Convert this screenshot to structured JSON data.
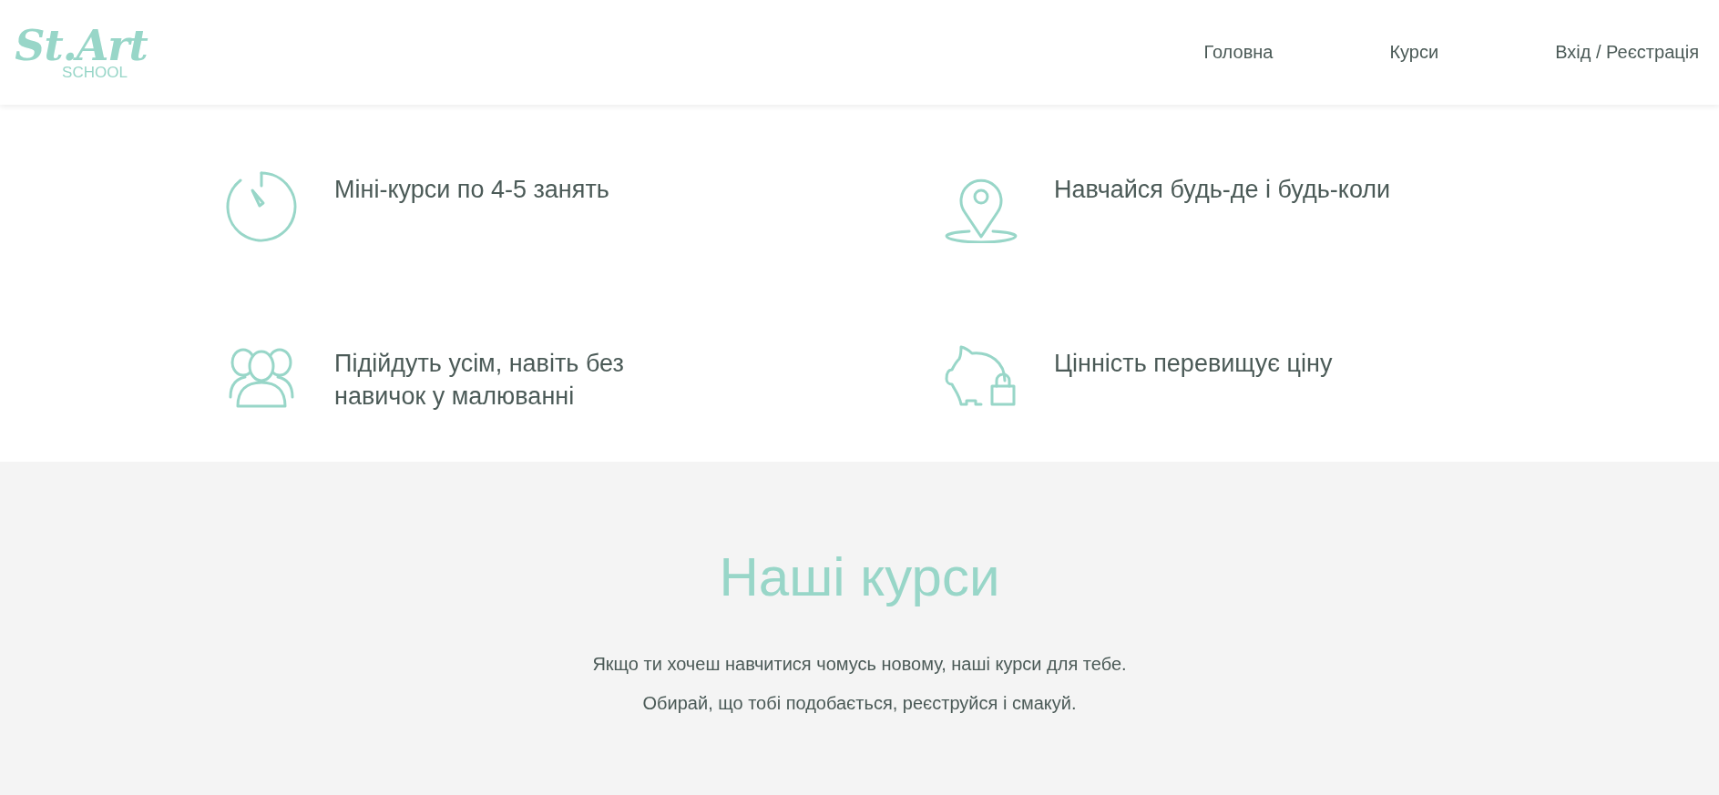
{
  "header": {
    "logo": {
      "title": "St.Art",
      "subtitle": "SCHOOL"
    },
    "nav": [
      {
        "label": "Головна"
      },
      {
        "label": "Курси"
      },
      {
        "label": "Вхід / Реєстрація"
      }
    ]
  },
  "features": [
    {
      "kind": "timer",
      "text": "Міні-курси по 4-5 занять"
    },
    {
      "kind": "pin",
      "text": "Навчайся будь-де і будь-коли"
    },
    {
      "kind": "people",
      "text": "Підійдуть усім, навіть без навичок у малюванні"
    },
    {
      "kind": "piggy",
      "text": "Цінність перевищує ціну"
    }
  ],
  "courses": {
    "title": "Наші курси",
    "lines": [
      "Якщо ти хочеш навчитися чомусь новому, наші курси для тебе.",
      "Обирай, що тобі подобається, реєструйся і смакуй."
    ]
  }
}
